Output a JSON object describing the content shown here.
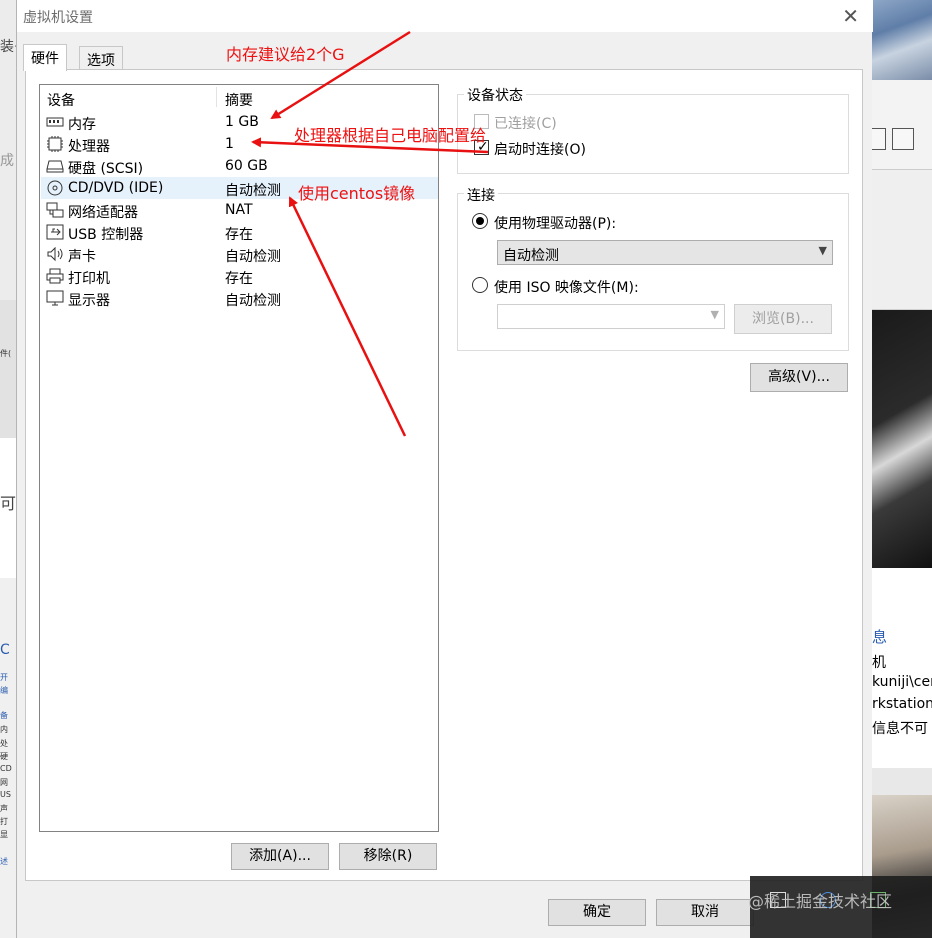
{
  "window": {
    "title": "虚拟机设置"
  },
  "tabs": [
    {
      "label": "硬件",
      "active": true
    },
    {
      "label": "选项",
      "active": false
    }
  ],
  "device_list": {
    "col_device": "设备",
    "col_summary": "摘要",
    "rows": [
      {
        "name": "内存",
        "summary": "1 GB",
        "icon": "memory-icon"
      },
      {
        "name": "处理器",
        "summary": "1",
        "icon": "processor-icon"
      },
      {
        "name": "硬盘 (SCSI)",
        "summary": "60 GB",
        "icon": "hard-disk-icon"
      },
      {
        "name": "CD/DVD (IDE)",
        "summary": "自动检测",
        "icon": "cd-dvd-icon",
        "selected": true
      },
      {
        "name": "网络适配器",
        "summary": "NAT",
        "icon": "network-adapter-icon"
      },
      {
        "name": "USB 控制器",
        "summary": "存在",
        "icon": "usb-controller-icon"
      },
      {
        "name": "声卡",
        "summary": "自动检测",
        "icon": "sound-card-icon"
      },
      {
        "name": "打印机",
        "summary": "存在",
        "icon": "printer-icon"
      },
      {
        "name": "显示器",
        "summary": "自动检测",
        "icon": "display-icon"
      }
    ]
  },
  "buttons": {
    "add": "添加(A)...",
    "remove": "移除(R)",
    "ok": "确定",
    "cancel": "取消",
    "advanced": "高级(V)...",
    "browse": "浏览(B)..."
  },
  "device_status": {
    "label": "设备状态",
    "connected": {
      "label": "已连接(C)",
      "checked": false,
      "enabled": false
    },
    "connect_on_start": {
      "label": "启动时连接(O)",
      "checked": true,
      "enabled": true
    }
  },
  "connection": {
    "label": "连接",
    "physical": {
      "label": "使用物理驱动器(P):",
      "selected": true,
      "drive_value": "自动检测"
    },
    "iso": {
      "label": "使用 ISO 映像文件(M):",
      "selected": false,
      "value": ""
    }
  },
  "annotations": {
    "memory": "内存建议给2个G",
    "processor": "处理器根据自己电脑配置给",
    "cd": "使用centos镜像",
    "color": "#e81010"
  },
  "background": {
    "left_fragments": [
      "装·",
      "成",
      "件(",
      "可",
      "C",
      "开",
      "编",
      "备",
      "内",
      "处",
      "硬",
      "CD",
      "网",
      "US",
      "声",
      "打",
      "显",
      "述"
    ],
    "right_info": {
      "heading": "息",
      "lines": [
        "机",
        "kuniji\\cen",
        "rkstation",
        "信息不可"
      ]
    },
    "watermark": "@稀土掘金技术社区"
  }
}
